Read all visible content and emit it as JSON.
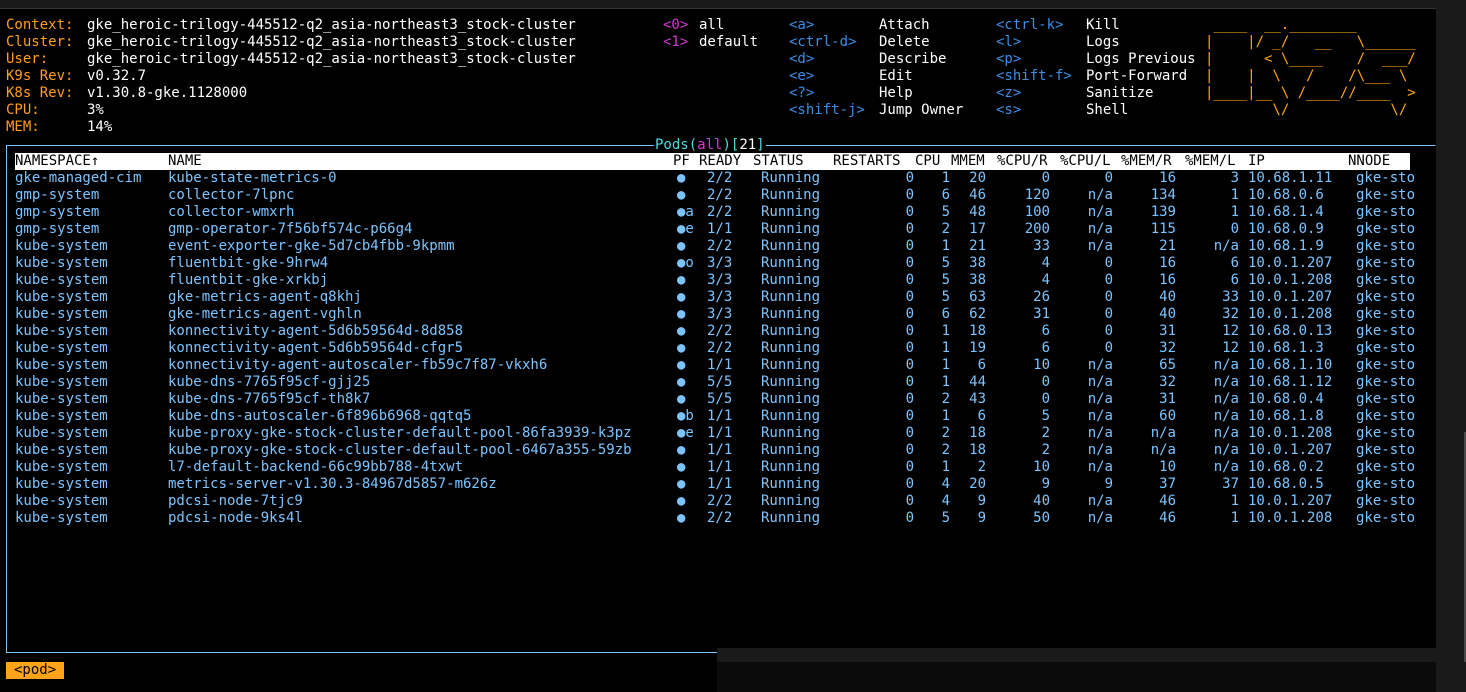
{
  "info": [
    {
      "key": "Context:",
      "value": "gke_heroic-trilogy-445512-q2_asia-northeast3_stock-cluster"
    },
    {
      "key": "Cluster:",
      "value": "gke_heroic-trilogy-445512-q2_asia-northeast3_stock-cluster"
    },
    {
      "key": "User:",
      "value": "gke_heroic-trilogy-445512-q2_asia-northeast3_stock-cluster"
    },
    {
      "key": "K9s Rev:",
      "value": "v0.32.7"
    },
    {
      "key": "K8s Rev:",
      "value": "v1.30.8-gke.1128000"
    },
    {
      "key": "CPU:",
      "value": "3%"
    },
    {
      "key": "MEM:",
      "value": "14%"
    }
  ],
  "namespaces": [
    {
      "key": "<0>",
      "label": "all"
    },
    {
      "key": "<1>",
      "label": "default"
    }
  ],
  "shortcuts_col1": [
    {
      "key": "<a>",
      "action": "Attach"
    },
    {
      "key": "<ctrl-d>",
      "action": "Delete"
    },
    {
      "key": "<d>",
      "action": "Describe"
    },
    {
      "key": "<e>",
      "action": "Edit"
    },
    {
      "key": "<?>",
      "action": "Help"
    },
    {
      "key": "<shift-j>",
      "action": "Jump Owner"
    }
  ],
  "shortcuts_col2": [
    {
      "key": "<ctrl-k>",
      "action": "Kill"
    },
    {
      "key": "<l>",
      "action": "Logs"
    },
    {
      "key": "<p>",
      "action": "Logs Previous"
    },
    {
      "key": "<shift-f>",
      "action": "Port-Forward"
    },
    {
      "key": "<z>",
      "action": "Sanitize"
    },
    {
      "key": "<s>",
      "action": "Shell"
    }
  ],
  "logo": " ____  __.________       \n|    |/ _/   __   \\______\n|      < \\____    /  ___/\n|    |  \\   /    /\\___ \\ \n|____|__ \\ /____//____  >\n        \\/            \\/ ",
  "panel": {
    "resource": "Pods",
    "scope": "all",
    "count": "21"
  },
  "columns": {
    "namespace": "NAMESPACE↑",
    "name": "NAME",
    "pf": "PF",
    "ready": "READY",
    "status": "STATUS",
    "restarts": "RESTARTS",
    "cpu": "CPU",
    "mmem": "MMEM",
    "cpur": "%CPU/R",
    "cpul": "%CPU/L",
    "memr": "%MEM/R",
    "meml": "%MEM/L",
    "ip": "IP",
    "node": "NNODE"
  },
  "pods": [
    {
      "namespace": "gke-managed-cim",
      "name": "kube-state-metrics-0",
      "pf": "●",
      "ready": "2/2",
      "status": "Running",
      "restarts": "0",
      "cpu": "1",
      "mmem": "20",
      "cpur": "0",
      "cpul": "0",
      "memr": "16",
      "meml": "3",
      "ip": "10.68.1.11",
      "node": "gke-sto"
    },
    {
      "namespace": "gmp-system",
      "name": "collector-7lpnc",
      "pf": "●",
      "ready": "2/2",
      "status": "Running",
      "restarts": "0",
      "cpu": "6",
      "mmem": "46",
      "cpur": "120",
      "cpul": "n/a",
      "memr": "134",
      "meml": "1",
      "ip": "10.68.0.6",
      "node": "gke-sto"
    },
    {
      "namespace": "gmp-system",
      "name": "collector-wmxrh",
      "pf": "●a",
      "ready": "2/2",
      "status": "Running",
      "restarts": "0",
      "cpu": "5",
      "mmem": "48",
      "cpur": "100",
      "cpul": "n/a",
      "memr": "139",
      "meml": "1",
      "ip": "10.68.1.4",
      "node": "gke-sto"
    },
    {
      "namespace": "gmp-system",
      "name": "gmp-operator-7f56bf574c-p66g4",
      "pf": "●e",
      "ready": "1/1",
      "status": "Running",
      "restarts": "0",
      "cpu": "2",
      "mmem": "17",
      "cpur": "200",
      "cpul": "n/a",
      "memr": "115",
      "meml": "0",
      "ip": "10.68.0.9",
      "node": "gke-sto"
    },
    {
      "namespace": "kube-system",
      "name": "event-exporter-gke-5d7cb4fbb-9kpmm",
      "pf": "●",
      "ready": "2/2",
      "status": "Running",
      "restarts": "0",
      "cpu": "1",
      "mmem": "21",
      "cpur": "33",
      "cpul": "n/a",
      "memr": "21",
      "meml": "n/a",
      "ip": "10.68.1.9",
      "node": "gke-sto"
    },
    {
      "namespace": "kube-system",
      "name": "fluentbit-gke-9hrw4",
      "pf": "●o",
      "ready": "3/3",
      "status": "Running",
      "restarts": "0",
      "cpu": "5",
      "mmem": "38",
      "cpur": "4",
      "cpul": "0",
      "memr": "16",
      "meml": "6",
      "ip": "10.0.1.207",
      "node": "gke-sto"
    },
    {
      "namespace": "kube-system",
      "name": "fluentbit-gke-xrkbj",
      "pf": "●",
      "ready": "3/3",
      "status": "Running",
      "restarts": "0",
      "cpu": "5",
      "mmem": "38",
      "cpur": "4",
      "cpul": "0",
      "memr": "16",
      "meml": "6",
      "ip": "10.0.1.208",
      "node": "gke-sto"
    },
    {
      "namespace": "kube-system",
      "name": "gke-metrics-agent-q8khj",
      "pf": "●",
      "ready": "3/3",
      "status": "Running",
      "restarts": "0",
      "cpu": "5",
      "mmem": "63",
      "cpur": "26",
      "cpul": "0",
      "memr": "40",
      "meml": "33",
      "ip": "10.0.1.207",
      "node": "gke-sto"
    },
    {
      "namespace": "kube-system",
      "name": "gke-metrics-agent-vghln",
      "pf": "●",
      "ready": "3/3",
      "status": "Running",
      "restarts": "0",
      "cpu": "6",
      "mmem": "62",
      "cpur": "31",
      "cpul": "0",
      "memr": "40",
      "meml": "32",
      "ip": "10.0.1.208",
      "node": "gke-sto"
    },
    {
      "namespace": "kube-system",
      "name": "konnectivity-agent-5d6b59564d-8d858",
      "pf": "●",
      "ready": "2/2",
      "status": "Running",
      "restarts": "0",
      "cpu": "1",
      "mmem": "18",
      "cpur": "6",
      "cpul": "0",
      "memr": "31",
      "meml": "12",
      "ip": "10.68.0.13",
      "node": "gke-sto"
    },
    {
      "namespace": "kube-system",
      "name": "konnectivity-agent-5d6b59564d-cfgr5",
      "pf": "●",
      "ready": "2/2",
      "status": "Running",
      "restarts": "0",
      "cpu": "1",
      "mmem": "19",
      "cpur": "6",
      "cpul": "0",
      "memr": "32",
      "meml": "12",
      "ip": "10.68.1.3",
      "node": "gke-sto"
    },
    {
      "namespace": "kube-system",
      "name": "konnectivity-agent-autoscaler-fb59c7f87-vkxh6",
      "pf": "●",
      "ready": "1/1",
      "status": "Running",
      "restarts": "0",
      "cpu": "1",
      "mmem": "6",
      "cpur": "10",
      "cpul": "n/a",
      "memr": "65",
      "meml": "n/a",
      "ip": "10.68.1.10",
      "node": "gke-sto"
    },
    {
      "namespace": "kube-system",
      "name": "kube-dns-7765f95cf-gjj25",
      "pf": "●",
      "ready": "5/5",
      "status": "Running",
      "restarts": "0",
      "cpu": "1",
      "mmem": "44",
      "cpur": "0",
      "cpul": "n/a",
      "memr": "32",
      "meml": "n/a",
      "ip": "10.68.1.12",
      "node": "gke-sto"
    },
    {
      "namespace": "kube-system",
      "name": "kube-dns-7765f95cf-th8k7",
      "pf": "●",
      "ready": "5/5",
      "status": "Running",
      "restarts": "0",
      "cpu": "2",
      "mmem": "43",
      "cpur": "0",
      "cpul": "n/a",
      "memr": "31",
      "meml": "n/a",
      "ip": "10.68.0.4",
      "node": "gke-sto"
    },
    {
      "namespace": "kube-system",
      "name": "kube-dns-autoscaler-6f896b6968-qqtq5",
      "pf": "●b",
      "ready": "1/1",
      "status": "Running",
      "restarts": "0",
      "cpu": "1",
      "mmem": "6",
      "cpur": "5",
      "cpul": "n/a",
      "memr": "60",
      "meml": "n/a",
      "ip": "10.68.1.8",
      "node": "gke-sto"
    },
    {
      "namespace": "kube-system",
      "name": "kube-proxy-gke-stock-cluster-default-pool-86fa3939-k3pz",
      "pf": "●e",
      "ready": "1/1",
      "status": "Running",
      "restarts": "0",
      "cpu": "2",
      "mmem": "18",
      "cpur": "2",
      "cpul": "n/a",
      "memr": "n/a",
      "meml": "n/a",
      "ip": "10.0.1.208",
      "node": "gke-sto"
    },
    {
      "namespace": "kube-system",
      "name": "kube-proxy-gke-stock-cluster-default-pool-6467a355-59zb",
      "pf": "●",
      "ready": "1/1",
      "status": "Running",
      "restarts": "0",
      "cpu": "2",
      "mmem": "18",
      "cpur": "2",
      "cpul": "n/a",
      "memr": "n/a",
      "meml": "n/a",
      "ip": "10.0.1.207",
      "node": "gke-sto"
    },
    {
      "namespace": "kube-system",
      "name": "l7-default-backend-66c99bb788-4txwt",
      "pf": "●",
      "ready": "1/1",
      "status": "Running",
      "restarts": "0",
      "cpu": "1",
      "mmem": "2",
      "cpur": "10",
      "cpul": "n/a",
      "memr": "10",
      "meml": "n/a",
      "ip": "10.68.0.2",
      "node": "gke-sto"
    },
    {
      "namespace": "kube-system",
      "name": "metrics-server-v1.30.3-84967d5857-m626z",
      "pf": "●",
      "ready": "1/1",
      "status": "Running",
      "restarts": "0",
      "cpu": "4",
      "mmem": "20",
      "cpur": "9",
      "cpul": "9",
      "memr": "37",
      "meml": "37",
      "ip": "10.68.0.5",
      "node": "gke-sto"
    },
    {
      "namespace": "kube-system",
      "name": "pdcsi-node-7tjc9",
      "pf": "●",
      "ready": "2/2",
      "status": "Running",
      "restarts": "0",
      "cpu": "4",
      "mmem": "9",
      "cpur": "40",
      "cpul": "n/a",
      "memr": "46",
      "meml": "1",
      "ip": "10.0.1.207",
      "node": "gke-sto"
    },
    {
      "namespace": "kube-system",
      "name": "pdcsi-node-9ks4l",
      "pf": "●",
      "ready": "2/2",
      "status": "Running",
      "restarts": "0",
      "cpu": "5",
      "mmem": "9",
      "cpur": "50",
      "cpul": "n/a",
      "memr": "46",
      "meml": "1",
      "ip": "10.0.1.208",
      "node": "gke-sto"
    }
  ],
  "crumb": "<pod>",
  "colors": {
    "accent": "#ffa31a",
    "row_text": "#7cc4ff",
    "key_blue": "#3a8ee6",
    "magenta": "#d33ad0",
    "title_cyan": "#4ad9e0"
  }
}
